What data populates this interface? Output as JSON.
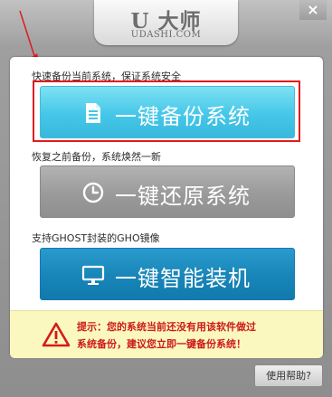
{
  "header": {
    "logo_main": "U 大师",
    "logo_sub": "UDASHI.COM",
    "close_label": "×"
  },
  "options": [
    {
      "label": "快速备份当前系统，保证系统安全",
      "button": "一键备份系统",
      "icon": "document-icon"
    },
    {
      "label": "恢复之前备份，系统焕然一新",
      "button": "一键还原系统",
      "icon": "clock-icon"
    },
    {
      "label": "支持GHOST封装的GHO镜像",
      "button": "一键智能装机",
      "icon": "monitor-icon"
    }
  ],
  "warning": {
    "line1": "提示：您的系统当前还没有用该软件做过",
    "line2": "系统备份，建议您立即一键备份系统！",
    "icon": "warning-triangle-icon"
  },
  "help_button": "使用帮助?",
  "colors": {
    "backup_button": "#44c7e8",
    "restore_button": "#9a9a9a",
    "install_button": "#1885b8",
    "highlight": "#e01b1b",
    "warning_text": "#cc1a1a",
    "warning_bg": "#fbf8bf"
  }
}
